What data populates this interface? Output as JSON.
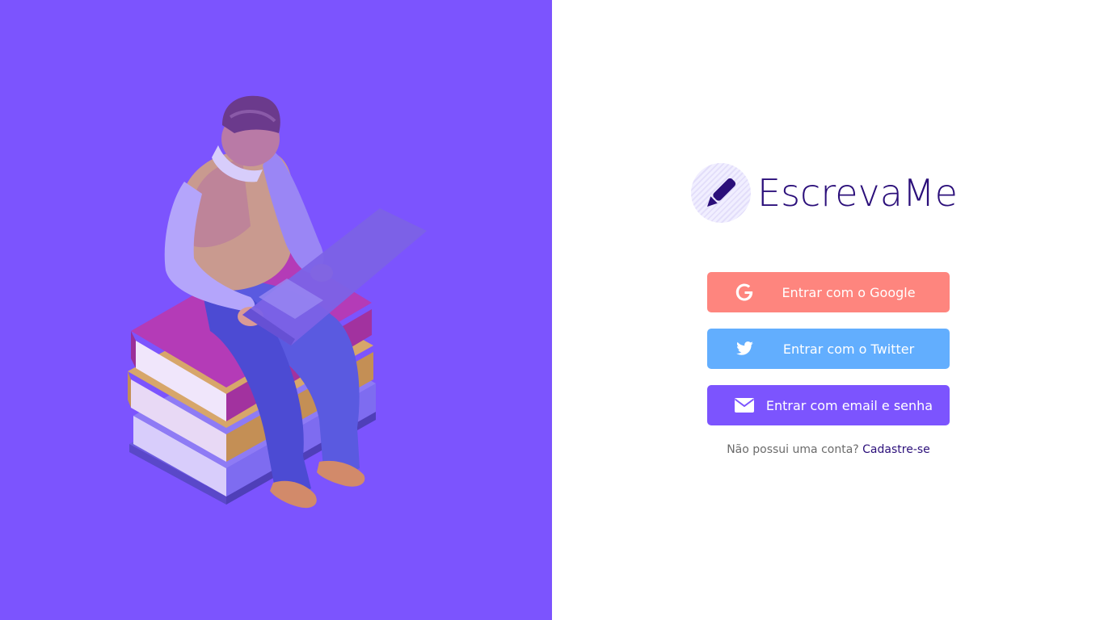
{
  "brand": {
    "name": "EscrevaMe",
    "color": "#2b0f7a",
    "logo_icon": "pencil-icon"
  },
  "illustration": {
    "icon": "person-with-laptop-on-books-illustration",
    "background": "#7c54fe"
  },
  "login": {
    "google": {
      "label": "Entrar com o Google",
      "icon": "google-icon",
      "color": "#fe857e"
    },
    "twitter": {
      "label": "Entrar com o Twitter",
      "icon": "twitter-icon",
      "color": "#62aefe"
    },
    "email": {
      "label": "Entrar com email e senha",
      "icon": "envelope-icon",
      "color": "#7c54fe"
    }
  },
  "signup": {
    "prompt": "Não possui uma conta?",
    "link": "Cadastre-se"
  }
}
